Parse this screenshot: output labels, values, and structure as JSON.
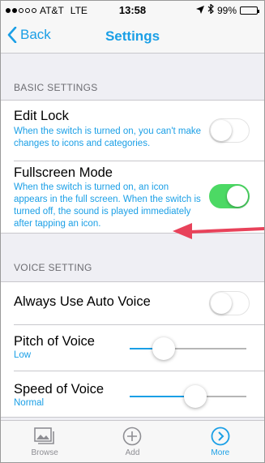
{
  "status_bar": {
    "carrier": "AT&T",
    "network": "LTE",
    "time": "13:58",
    "battery": "99%",
    "battery_level": 0.99
  },
  "nav": {
    "back_label": "Back",
    "title": "Settings"
  },
  "sections": {
    "basic": {
      "header": "BASIC SETTINGS",
      "edit_lock": {
        "label": "Edit Lock",
        "description": "When the switch is turned on, you can't make changes to icons and categories.",
        "on": false
      },
      "fullscreen": {
        "label": "Fullscreen Mode",
        "description": "When the switch is turned on, an icon appears in the full screen. When the switch is turned off, the sound is played immediately after tapping an icon.",
        "on": true
      }
    },
    "voice": {
      "header": "VOICE SETTING",
      "auto_voice": {
        "label": "Always Use Auto Voice",
        "on": false
      },
      "pitch": {
        "label": "Pitch of Voice",
        "value_label": "Low",
        "level": 0.29
      },
      "speed": {
        "label": "Speed of Voice",
        "value_label": "Normal",
        "level": 0.56
      }
    }
  },
  "tabbar": {
    "browse": "Browse",
    "add": "Add",
    "more": "More"
  },
  "colors": {
    "accent": "#1a9fe6",
    "switch_on": "#4cd964",
    "annotation_arrow": "#e8425a"
  }
}
